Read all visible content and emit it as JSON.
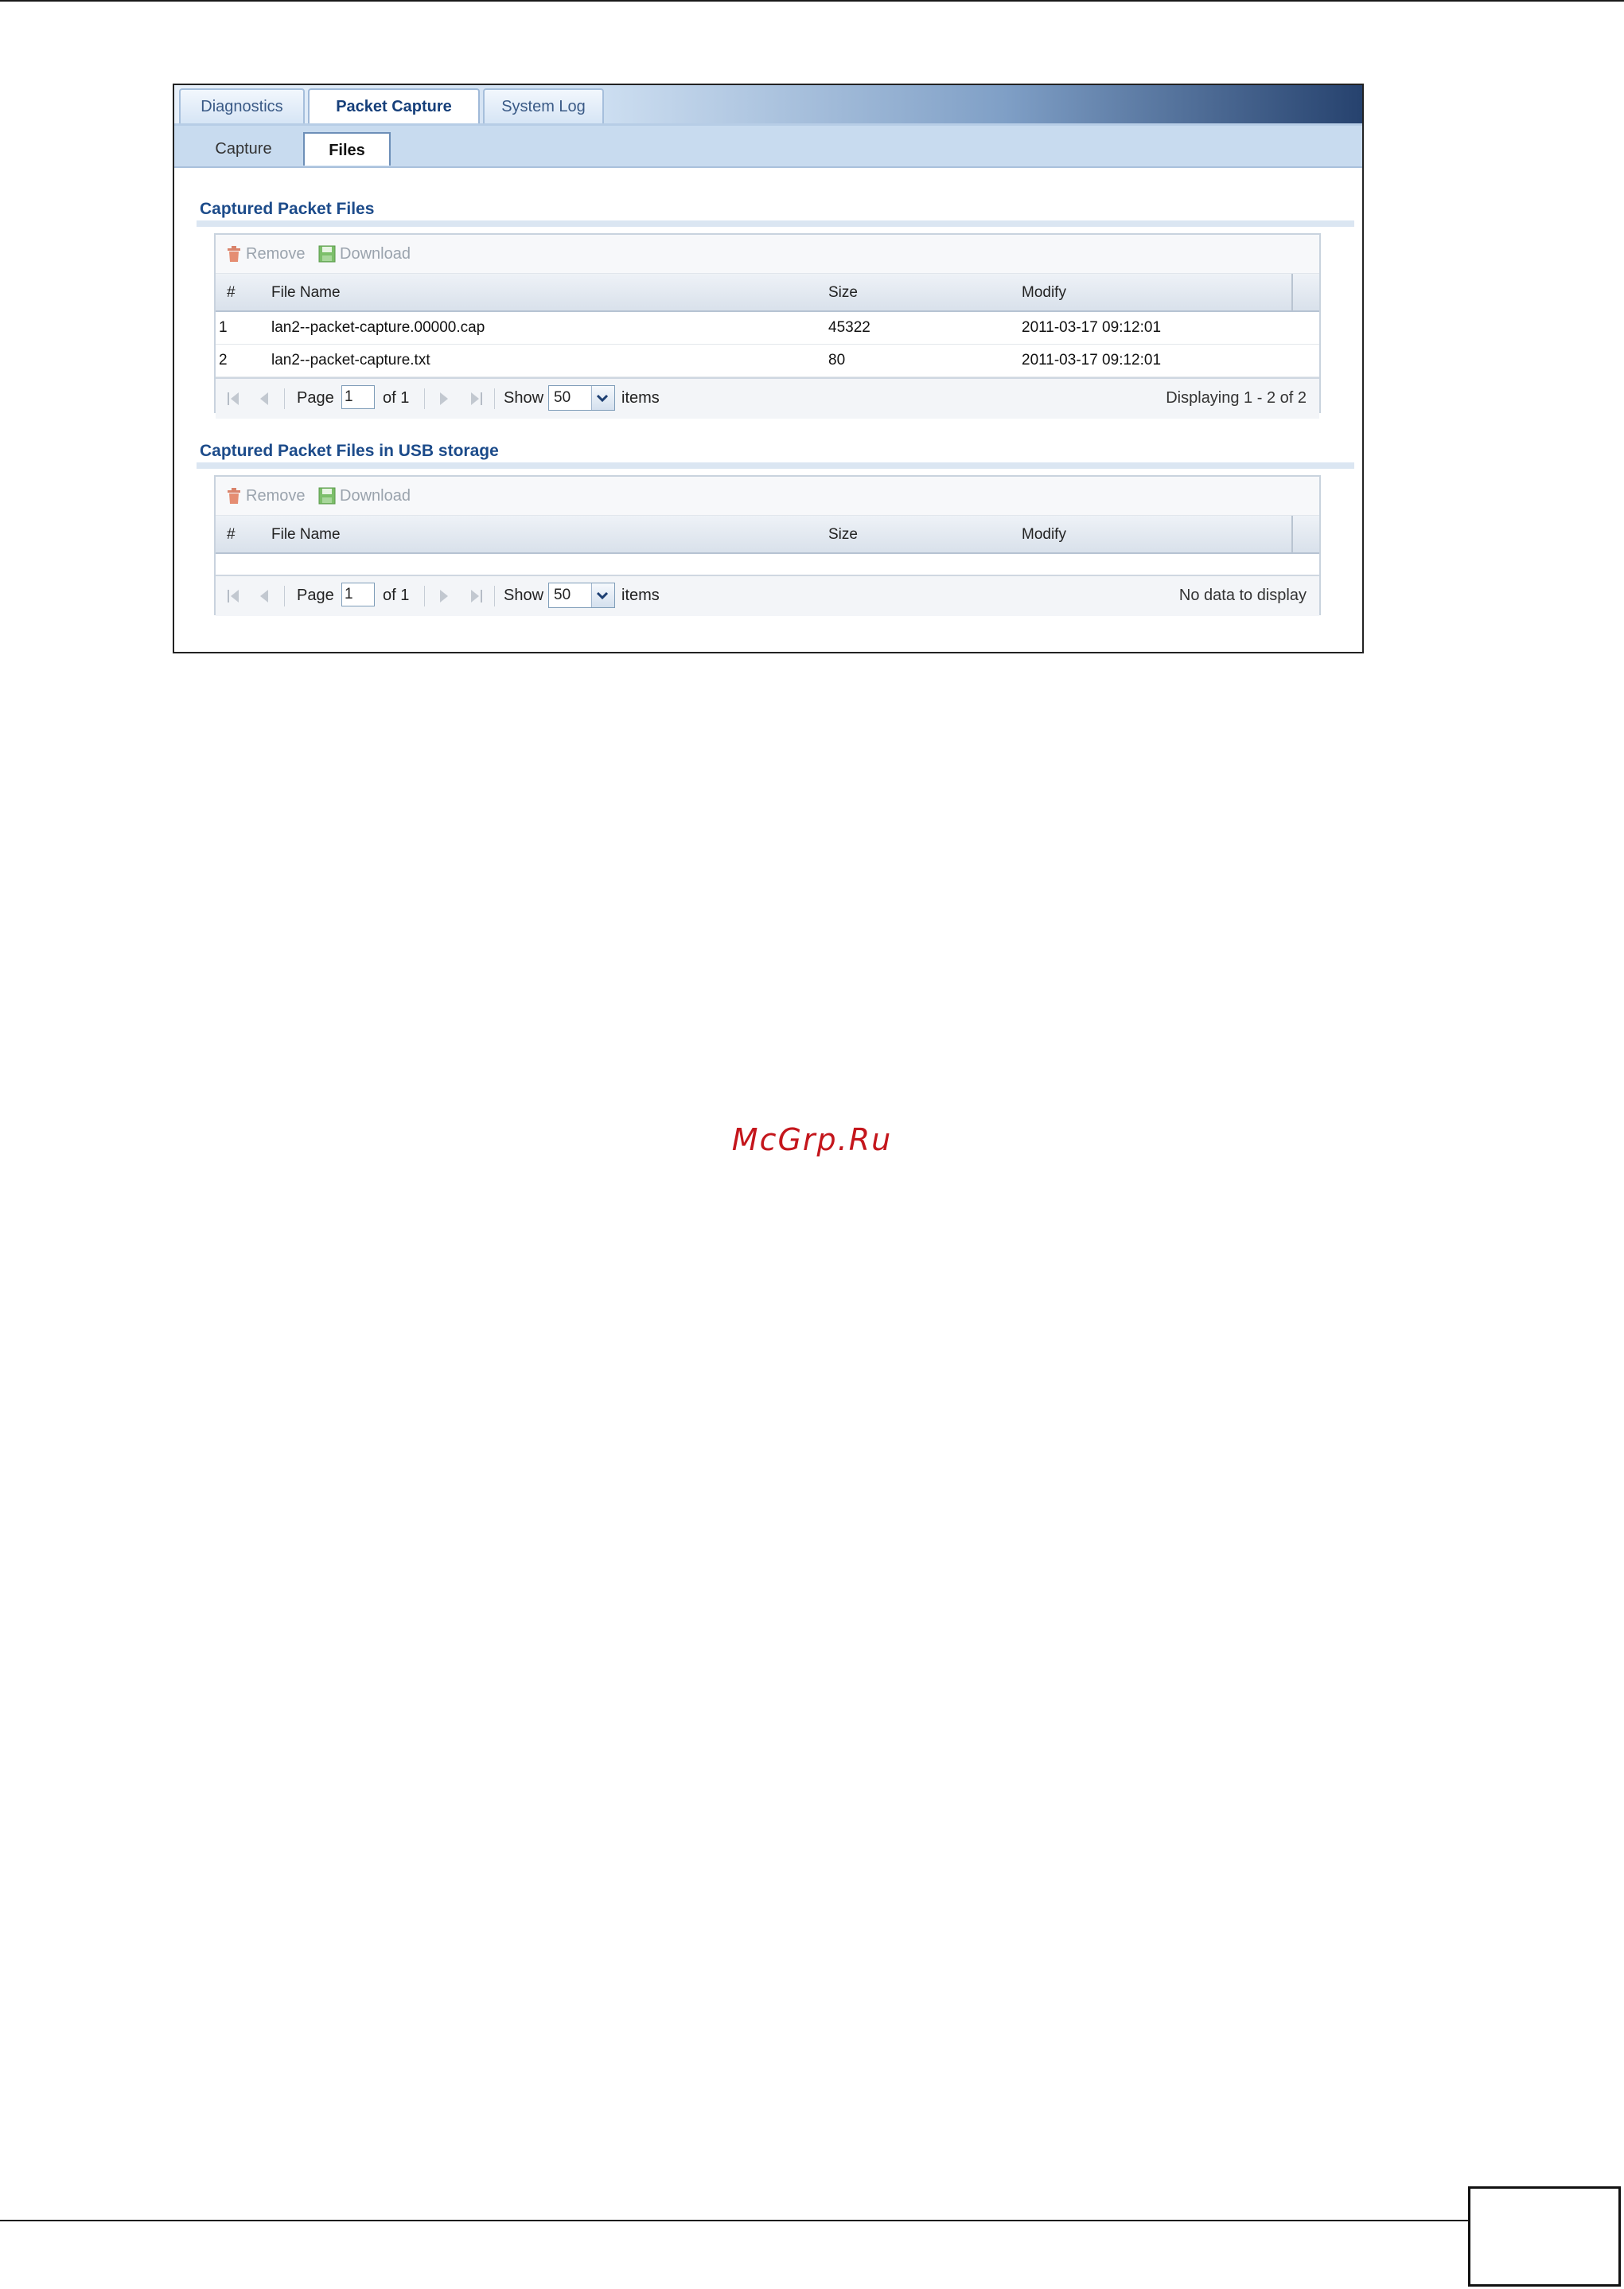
{
  "tabs": [
    {
      "label": "Diagnostics",
      "active": false
    },
    {
      "label": "Packet Capture",
      "active": true
    },
    {
      "label": "System Log",
      "active": false
    }
  ],
  "subtabs": [
    {
      "label": "Capture",
      "active": false
    },
    {
      "label": "Files",
      "active": true
    }
  ],
  "sections": {
    "captured": {
      "title": "Captured Packet Files",
      "toolbar": {
        "remove": "Remove",
        "download": "Download"
      },
      "columns": [
        "#",
        "File Name",
        "Size",
        "Modify"
      ],
      "rows": [
        {
          "num": "1",
          "name": "lan2--packet-capture.00000.cap",
          "size": "45322",
          "modify": "2011-03-17 09:12:01"
        },
        {
          "num": "2",
          "name": "lan2--packet-capture.txt",
          "size": "80",
          "modify": "2011-03-17 09:12:01"
        }
      ],
      "pager": {
        "page_label": "Page",
        "page_value": "1",
        "of_label": "of 1",
        "show_label": "Show",
        "show_value": "50",
        "items_label": "items",
        "status": "Displaying 1 - 2 of 2"
      }
    },
    "usb": {
      "title": "Captured Packet Files in USB storage",
      "toolbar": {
        "remove": "Remove",
        "download": "Download"
      },
      "columns": [
        "#",
        "File Name",
        "Size",
        "Modify"
      ],
      "pager": {
        "page_label": "Page",
        "page_value": "1",
        "of_label": "of 1",
        "show_label": "Show",
        "show_value": "50",
        "items_label": "items",
        "status": "No data to display"
      }
    }
  },
  "watermark": "McGrp.Ru",
  "colors": {
    "section_title": "#1c4b8a",
    "watermark": "#c4161c",
    "tabbar_dark": "#26426e"
  }
}
